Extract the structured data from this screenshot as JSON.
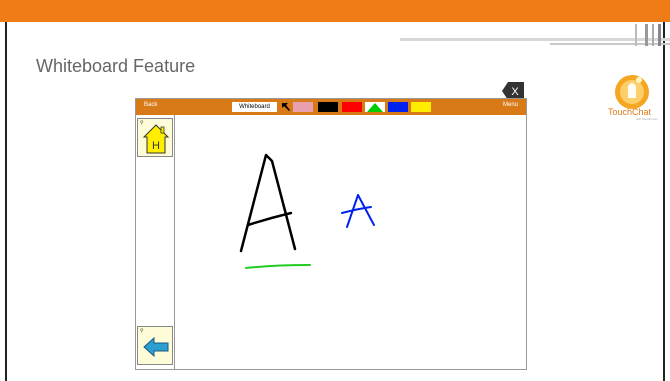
{
  "slide": {
    "title": "Whiteboard Feature",
    "logo_text": "TouchChat",
    "logo_sub": "with WordPower"
  },
  "colors": {
    "top_bar": "#f07c18",
    "toolbar": "#d87a18",
    "button_bg": "#fefcd8"
  },
  "app": {
    "toolbar": {
      "back_label": "Back",
      "whiteboard_label": "Whiteboard",
      "menu_label": "Menu",
      "tools": [
        {
          "name": "pointer-tool",
          "icon": "arrow-up-left-icon",
          "color": "#000000"
        },
        {
          "name": "eraser-tool",
          "icon": "eraser-icon",
          "color": "#e8a0b0"
        },
        {
          "name": "color-black",
          "color": "#000000"
        },
        {
          "name": "color-red",
          "color": "#ff0000"
        },
        {
          "name": "color-green",
          "color": "#00cc00"
        },
        {
          "name": "color-blue",
          "color": "#0022ee"
        },
        {
          "name": "color-yellow",
          "color": "#ffee00"
        }
      ]
    },
    "side_buttons": [
      {
        "name": "home-button",
        "icon": "house-icon",
        "label": "H"
      },
      {
        "name": "back-arrow-button",
        "icon": "arrow-left-icon"
      }
    ],
    "close_label": "X"
  }
}
